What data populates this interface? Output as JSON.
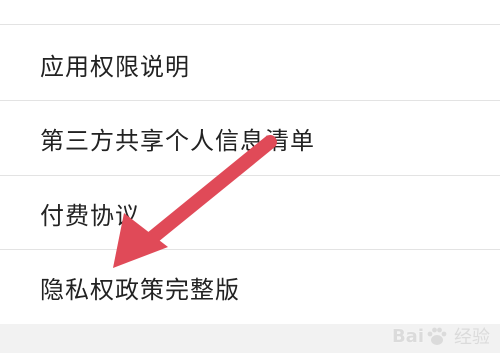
{
  "settings_list": {
    "items": [
      {
        "label": "应用权限说明"
      },
      {
        "label": "第三方共享个人信息清单"
      },
      {
        "label": "付费协议"
      },
      {
        "label": "隐私权政策完整版"
      }
    ]
  },
  "annotation": {
    "arrow_color": "#e04a58",
    "arrow_target": "隐私权政策完整版"
  },
  "watermark": {
    "brand": "Bai",
    "brand_suffix": "经验"
  }
}
